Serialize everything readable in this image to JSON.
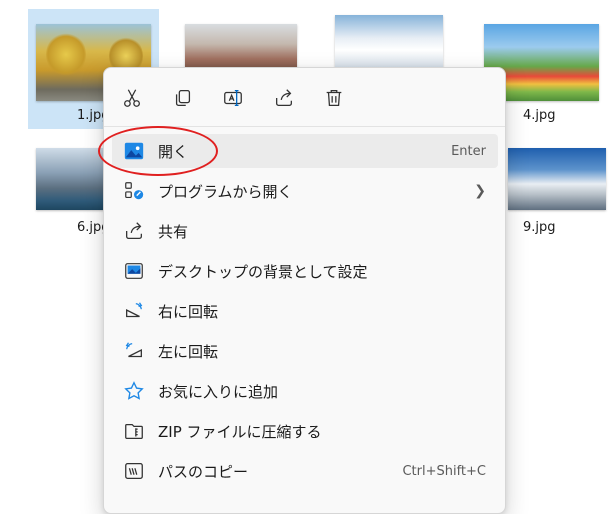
{
  "files": {
    "items": [
      {
        "label": "1.jpg",
        "selected": true
      },
      {
        "label": "",
        "selected": false
      },
      {
        "label": "",
        "selected": false
      },
      {
        "label": "4.jpg",
        "selected": false
      },
      {
        "label": "6.jpg",
        "selected": false
      },
      {
        "label": "9.jpg",
        "selected": false
      }
    ]
  },
  "context_menu": {
    "toolbar": [
      "cut-icon",
      "copy-icon",
      "rename-icon",
      "share-icon",
      "delete-icon"
    ],
    "items": [
      {
        "label": "開く",
        "shortcut": "Enter",
        "icon": "photos-icon",
        "highlighted": true
      },
      {
        "label": "プログラムから開く",
        "submenu": true,
        "icon": "open-with-icon"
      },
      {
        "label": "共有",
        "icon": "share-icon"
      },
      {
        "label": "デスクトップの背景として設定",
        "icon": "set-background-icon"
      },
      {
        "label": "右に回転",
        "icon": "rotate-right-icon"
      },
      {
        "label": "左に回転",
        "icon": "rotate-left-icon"
      },
      {
        "label": "お気に入りに追加",
        "icon": "star-icon"
      },
      {
        "label": "ZIP ファイルに圧縮する",
        "icon": "zip-folder-icon"
      },
      {
        "label": "パスのコピー",
        "shortcut": "Ctrl+Shift+C",
        "icon": "copy-path-icon"
      }
    ]
  },
  "annotation_color": "#e02020",
  "accent_color": "#0067c0"
}
